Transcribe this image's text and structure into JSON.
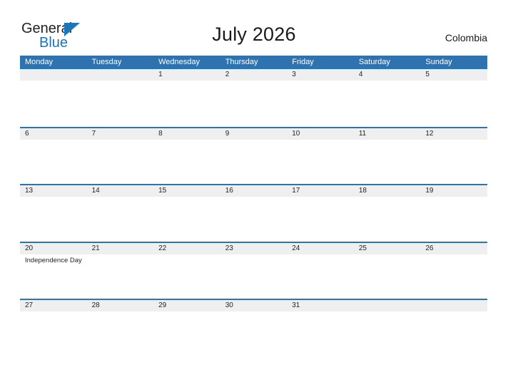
{
  "brand": {
    "name_part1": "General",
    "name_part2": "Blue",
    "triangle_color": "#1b75bb"
  },
  "header": {
    "title": "July 2026",
    "country": "Colombia"
  },
  "theme": {
    "header_blue": "#2e72b0",
    "row_line_blue": "#2e72b0",
    "day_band_gray": "#efefef",
    "text_dark": "#231f20",
    "page_background": "#ffffff"
  },
  "calendar": {
    "weekdays": [
      "Monday",
      "Tuesday",
      "Wednesday",
      "Thursday",
      "Friday",
      "Saturday",
      "Sunday"
    ],
    "weeks": [
      {
        "days": [
          {
            "number": "",
            "events": []
          },
          {
            "number": "",
            "events": []
          },
          {
            "number": "1",
            "events": []
          },
          {
            "number": "2",
            "events": []
          },
          {
            "number": "3",
            "events": []
          },
          {
            "number": "4",
            "events": []
          },
          {
            "number": "5",
            "events": []
          }
        ]
      },
      {
        "days": [
          {
            "number": "6",
            "events": []
          },
          {
            "number": "7",
            "events": []
          },
          {
            "number": "8",
            "events": []
          },
          {
            "number": "9",
            "events": []
          },
          {
            "number": "10",
            "events": []
          },
          {
            "number": "11",
            "events": []
          },
          {
            "number": "12",
            "events": []
          }
        ]
      },
      {
        "days": [
          {
            "number": "13",
            "events": []
          },
          {
            "number": "14",
            "events": []
          },
          {
            "number": "15",
            "events": []
          },
          {
            "number": "16",
            "events": []
          },
          {
            "number": "17",
            "events": []
          },
          {
            "number": "18",
            "events": []
          },
          {
            "number": "19",
            "events": []
          }
        ]
      },
      {
        "days": [
          {
            "number": "20",
            "events": [
              "Independence Day"
            ]
          },
          {
            "number": "21",
            "events": []
          },
          {
            "number": "22",
            "events": []
          },
          {
            "number": "23",
            "events": []
          },
          {
            "number": "24",
            "events": []
          },
          {
            "number": "25",
            "events": []
          },
          {
            "number": "26",
            "events": []
          }
        ]
      },
      {
        "days": [
          {
            "number": "27",
            "events": []
          },
          {
            "number": "28",
            "events": []
          },
          {
            "number": "29",
            "events": []
          },
          {
            "number": "30",
            "events": []
          },
          {
            "number": "31",
            "events": []
          },
          {
            "number": "",
            "events": []
          },
          {
            "number": "",
            "events": []
          }
        ]
      }
    ]
  }
}
